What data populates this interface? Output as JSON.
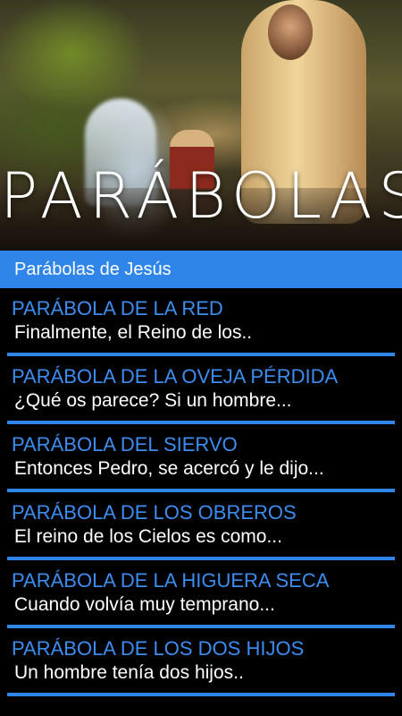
{
  "hero": {
    "title": "PARÁBOLAS"
  },
  "header": {
    "label": "Parábolas de Jesús",
    "color": "#2f86e8"
  },
  "list": {
    "items": [
      {
        "title": "PARÁBOLA DE LA RED",
        "snippet": "Finalmente, el Reino de los.."
      },
      {
        "title": "PARÁBOLA DE LA OVEJA PÉRDIDA",
        "snippet": "¿Qué os parece? Si un hombre..."
      },
      {
        "title": "PARÁBOLA DEL SIERVO",
        "snippet": "Entonces Pedro, se acercó y le dijo..."
      },
      {
        "title": "PARÁBOLA DE LOS OBREROS",
        "snippet": "El reino de los Cielos es como..."
      },
      {
        "title": "PARÁBOLA DE LA HIGUERA SECA",
        "snippet": "Cuando volvía muy temprano..."
      },
      {
        "title": "PARÁBOLA DE LOS DOS HIJOS",
        "snippet": "Un hombre tenía dos hijos.."
      }
    ],
    "title_color": "#3b8df0",
    "divider_color": "#2f86e8"
  }
}
